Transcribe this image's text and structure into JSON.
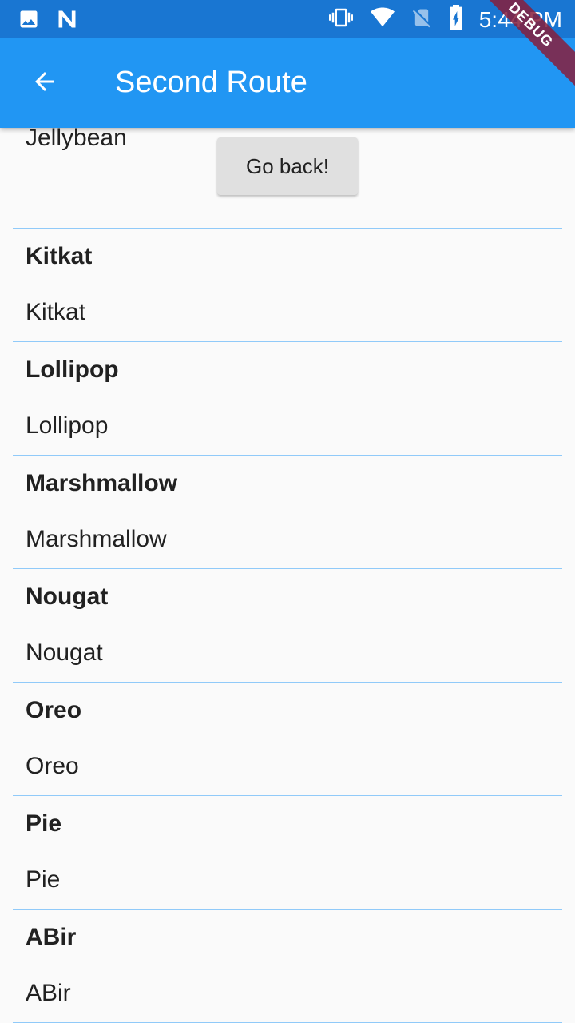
{
  "status_bar": {
    "time": "5:44 PM",
    "left_icons": [
      "image-icon",
      "n-logo-icon"
    ],
    "right_icons": [
      "vibrate-icon",
      "wifi-icon",
      "no-sim-icon",
      "battery-charging-icon"
    ]
  },
  "debug_banner": "DEBUG",
  "app_bar": {
    "title": "Second Route",
    "back_icon": "arrow-back-icon"
  },
  "go_back_button": "Go back!",
  "partial_item": {
    "subtitle": "Jellybean"
  },
  "items": [
    {
      "title": "Kitkat",
      "subtitle": "Kitkat"
    },
    {
      "title": "Lollipop",
      "subtitle": "Lollipop"
    },
    {
      "title": "Marshmallow",
      "subtitle": "Marshmallow"
    },
    {
      "title": "Nougat",
      "subtitle": "Nougat"
    },
    {
      "title": "Oreo",
      "subtitle": "Oreo"
    },
    {
      "title": "Pie",
      "subtitle": "Pie"
    },
    {
      "title": "ABir",
      "subtitle": "ABir"
    }
  ],
  "colors": {
    "status_bar": "#1976d2",
    "app_bar": "#2196f3",
    "divider": "#90caf9",
    "background": "#fafafa"
  }
}
